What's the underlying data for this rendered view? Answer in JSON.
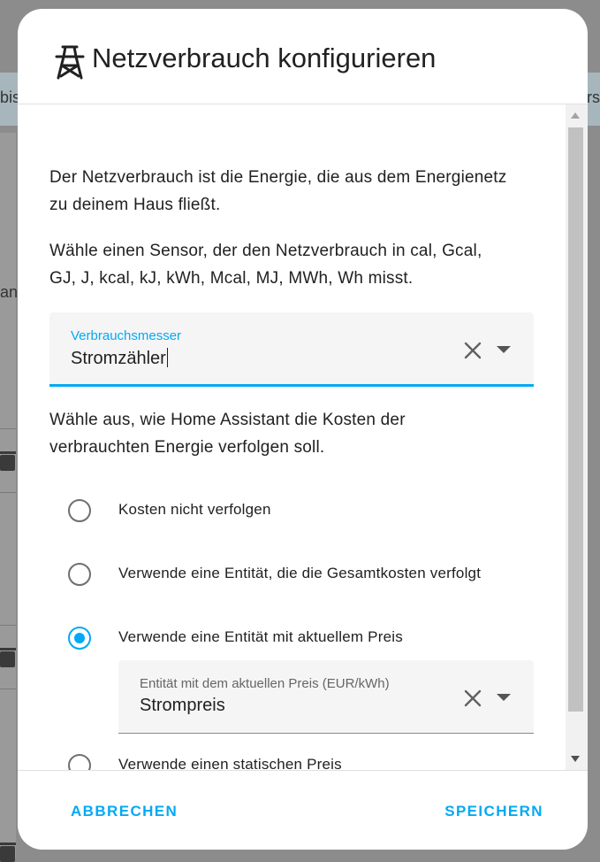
{
  "background": {
    "left_fragment": "bis",
    "right_fragment": "rs",
    "left_mid_fragment": "ant"
  },
  "dialog": {
    "title": "Netzverbrauch konfigurieren",
    "icon": "transmission-tower-icon",
    "intro_text": "Der Netzverbrauch ist die Energie, die aus dem Energienetz zu deinem Haus fließt.",
    "sensor_help": "Wähle einen Sensor, der den Netzverbrauch in cal, Gcal, GJ, J, kcal, kJ, kWh, Mcal, MJ, MWh, Wh misst.",
    "meter_field": {
      "label": "Verbrauchsmesser",
      "value": "Stromzähler"
    },
    "cost_help": "Wähle aus, wie Home Assistant die Kosten der verbrauchten Energie verfolgen soll.",
    "cost_options": [
      {
        "label": "Kosten nicht verfolgen",
        "selected": false
      },
      {
        "label": "Verwende eine Entität, die die Gesamtkosten verfolgt",
        "selected": false
      },
      {
        "label": "Verwende eine Entität mit aktuellem Preis",
        "selected": true
      },
      {
        "label": "Verwende einen statischen Preis",
        "selected": false
      }
    ],
    "price_field": {
      "label": "Entität mit dem aktuellen Preis (EUR/kWh)",
      "value": "Strompreis"
    },
    "cancel_label": "ABBRECHEN",
    "save_label": "SPEICHERN"
  },
  "colors": {
    "accent": "#03a9f4",
    "text": "#212121",
    "scrim": "#8c8c8c"
  }
}
